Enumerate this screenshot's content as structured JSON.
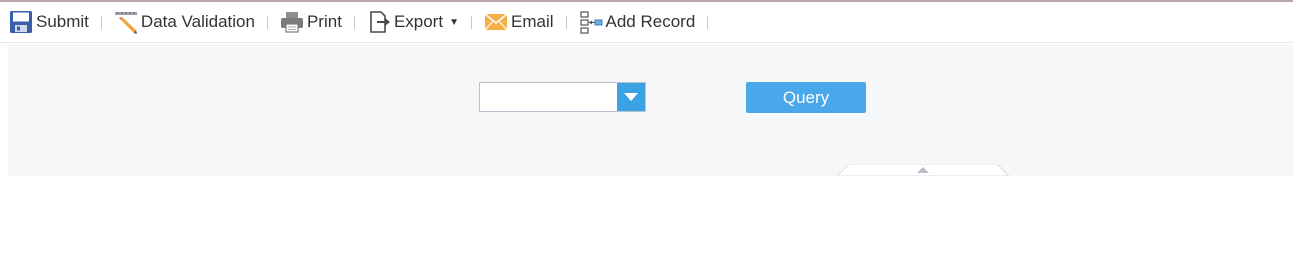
{
  "toolbar": {
    "items": [
      {
        "label": "Submit",
        "icon": "floppy-disk-icon"
      },
      {
        "label": "Data Validation",
        "icon": "pencil-ruler-icon"
      },
      {
        "label": "Print",
        "icon": "printer-icon"
      },
      {
        "label": "Export",
        "icon": "export-icon",
        "has_dropdown": true
      },
      {
        "label": "Email",
        "icon": "envelope-icon"
      },
      {
        "label": "Add Record",
        "icon": "add-record-icon"
      }
    ]
  },
  "filter": {
    "select_value": "",
    "query_label": "Query"
  },
  "colors": {
    "accent": "#48a8ea",
    "dropdown_button": "#3ba3e3",
    "panel_background": "#f6f7f9"
  }
}
